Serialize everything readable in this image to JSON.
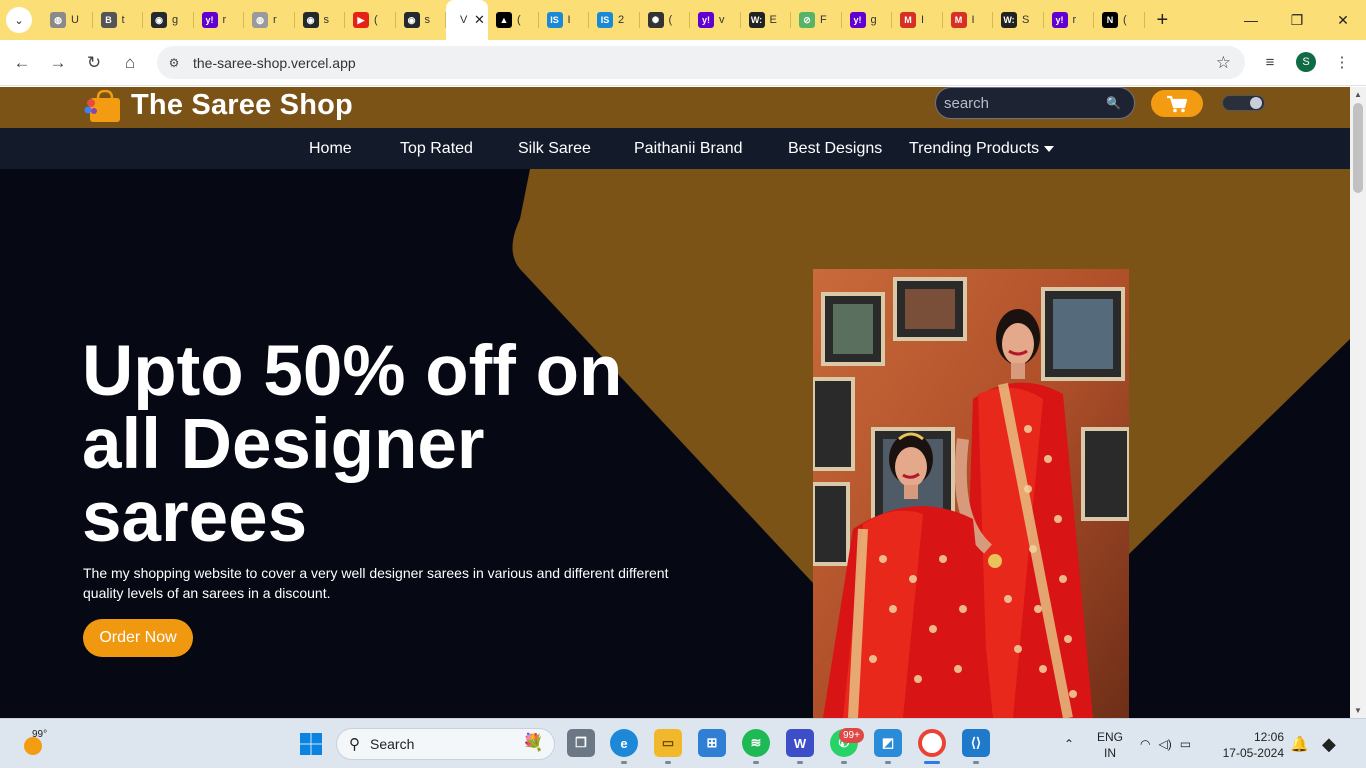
{
  "browser": {
    "tabs": [
      {
        "title": "U",
        "icon": "globe-icon",
        "color": "#8a8a8a",
        "glyph": "◍"
      },
      {
        "title": "t",
        "icon": "b-icon",
        "color": "#555555",
        "glyph": "B"
      },
      {
        "title": "g",
        "icon": "github-icon",
        "color": "#24292e",
        "glyph": "◉"
      },
      {
        "title": "r",
        "icon": "yahoo-icon",
        "color": "#6001d2",
        "glyph": "y!"
      },
      {
        "title": "r",
        "icon": "globe-icon",
        "color": "#9a9a9a",
        "glyph": "◍"
      },
      {
        "title": "s",
        "icon": "github-icon",
        "color": "#24292e",
        "glyph": "◉"
      },
      {
        "title": "(",
        "icon": "youtube-icon",
        "color": "#e62117",
        "glyph": "▶"
      },
      {
        "title": "s",
        "icon": "github-icon",
        "color": "#24292e",
        "glyph": "◉"
      },
      {
        "title": "V",
        "icon": "vercel-icon",
        "color": "#ffffff",
        "glyph": "",
        "active": true
      },
      {
        "title": "(",
        "icon": "next-icon",
        "color": "#000000",
        "glyph": "▲"
      },
      {
        "title": "I",
        "icon": "is-icon",
        "color": "#1a8ad6",
        "glyph": "IS"
      },
      {
        "title": "2",
        "icon": "is-icon",
        "color": "#1a8ad6",
        "glyph": "IS"
      },
      {
        "title": "(",
        "icon": "openai-icon",
        "color": "#333333",
        "glyph": "✺"
      },
      {
        "title": "v",
        "icon": "yahoo-icon",
        "color": "#6001d2",
        "glyph": "y!"
      },
      {
        "title": "E",
        "icon": "w-icon",
        "color": "#222222",
        "glyph": "W:"
      },
      {
        "title": "F",
        "icon": "leaf-icon",
        "color": "#58b368",
        "glyph": "⊘"
      },
      {
        "title": "g",
        "icon": "yahoo-icon",
        "color": "#6001d2",
        "glyph": "y!"
      },
      {
        "title": "I",
        "icon": "gmail-icon",
        "color": "#d93025",
        "glyph": "M"
      },
      {
        "title": "I",
        "icon": "gmail-icon",
        "color": "#d93025",
        "glyph": "M"
      },
      {
        "title": "S",
        "icon": "w-icon",
        "color": "#222222",
        "glyph": "W:"
      },
      {
        "title": "r",
        "icon": "yahoo-icon",
        "color": "#6001d2",
        "glyph": "y!"
      },
      {
        "title": "(",
        "icon": "next-icon",
        "color": "#000000",
        "glyph": "N"
      }
    ],
    "url": "the-saree-shop.vercel.app",
    "profile_initial": "S"
  },
  "site": {
    "brand": "The Saree Shop",
    "search_placeholder": "search",
    "nav": [
      "Home",
      "Top Rated",
      "Silk Saree",
      "Paithanii Brand",
      "Best Designs",
      "Trending Products"
    ],
    "hero": {
      "title": "Upto 50% off on all Designer sarees",
      "description": "The my shopping website to cover a very well designer sarees in various and different different quality levels of an sarees in a discount.",
      "cta": "Order Now"
    },
    "colors": {
      "header": "#7b5317",
      "nav": "#131a2a",
      "background": "#060914",
      "accent": "#f0980f"
    }
  },
  "taskbar": {
    "temperature": "99°",
    "search_label": "Search",
    "whatsapp_badge": "99+",
    "language_line1": "ENG",
    "language_line2": "IN",
    "time": "12:06",
    "date": "17-05-2024"
  }
}
